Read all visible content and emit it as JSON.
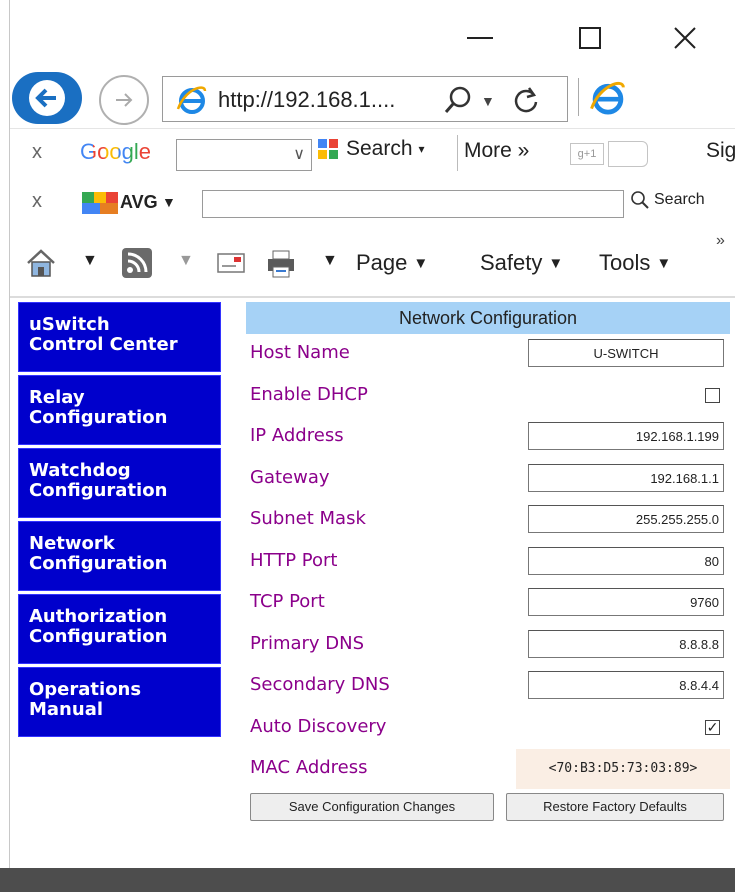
{
  "window": {
    "address_url": "http://192.168.1....",
    "icons": {
      "minimize": "minimize-icon",
      "maximize": "maximize-icon",
      "close": "close-icon"
    }
  },
  "google_toolbar": {
    "logo": "Google",
    "search_label": "Search",
    "more_label": "More »",
    "gplus_label": "g+1",
    "sign_in_label": "Sig"
  },
  "avg_toolbar": {
    "logo": "AVG",
    "search_label": "Search"
  },
  "command_bar": {
    "page_label": "Page",
    "safety_label": "Safety",
    "tools_label": "Tools",
    "more_chevron": "»"
  },
  "sidebar": {
    "items": [
      {
        "line1": "uSwitch",
        "line2": "Control Center"
      },
      {
        "line1": "Relay",
        "line2": "Configuration"
      },
      {
        "line1": "Watchdog",
        "line2": "Configuration"
      },
      {
        "line1": "Network",
        "line2": "Configuration"
      },
      {
        "line1": "Authorization",
        "line2": "Configuration"
      },
      {
        "line1": "Operations",
        "line2": "Manual"
      }
    ]
  },
  "network_config": {
    "title": "Network Configuration",
    "host_name": {
      "label": "Host Name",
      "value": "U-SWITCH"
    },
    "enable_dhcp": {
      "label": "Enable DHCP",
      "checked": false
    },
    "ip_address": {
      "label": "IP Address",
      "value": "192.168.1.199"
    },
    "gateway": {
      "label": "Gateway",
      "value": "192.168.1.1"
    },
    "subnet_mask": {
      "label": "Subnet Mask",
      "value": "255.255.255.0"
    },
    "http_port": {
      "label": "HTTP Port",
      "value": "80"
    },
    "tcp_port": {
      "label": "TCP Port",
      "value": "9760"
    },
    "primary_dns": {
      "label": "Primary DNS",
      "value": "8.8.8.8"
    },
    "secondary_dns": {
      "label": "Secondary DNS",
      "value": "8.8.4.4"
    },
    "auto_discovery": {
      "label": "Auto Discovery",
      "checked": true,
      "mark": "✓"
    },
    "mac_address": {
      "label": "MAC Address",
      "value": "<70:B3:D5:73:03:89>"
    },
    "save_button": "Save Configuration Changes",
    "restore_button": "Restore Factory Defaults"
  },
  "colors": {
    "nav_bg": "#0000cc",
    "label_color": "#8b008b",
    "panel_header_bg": "#a6d2f6",
    "mac_bg": "#faeee4",
    "back_button": "#1a6fc2"
  }
}
